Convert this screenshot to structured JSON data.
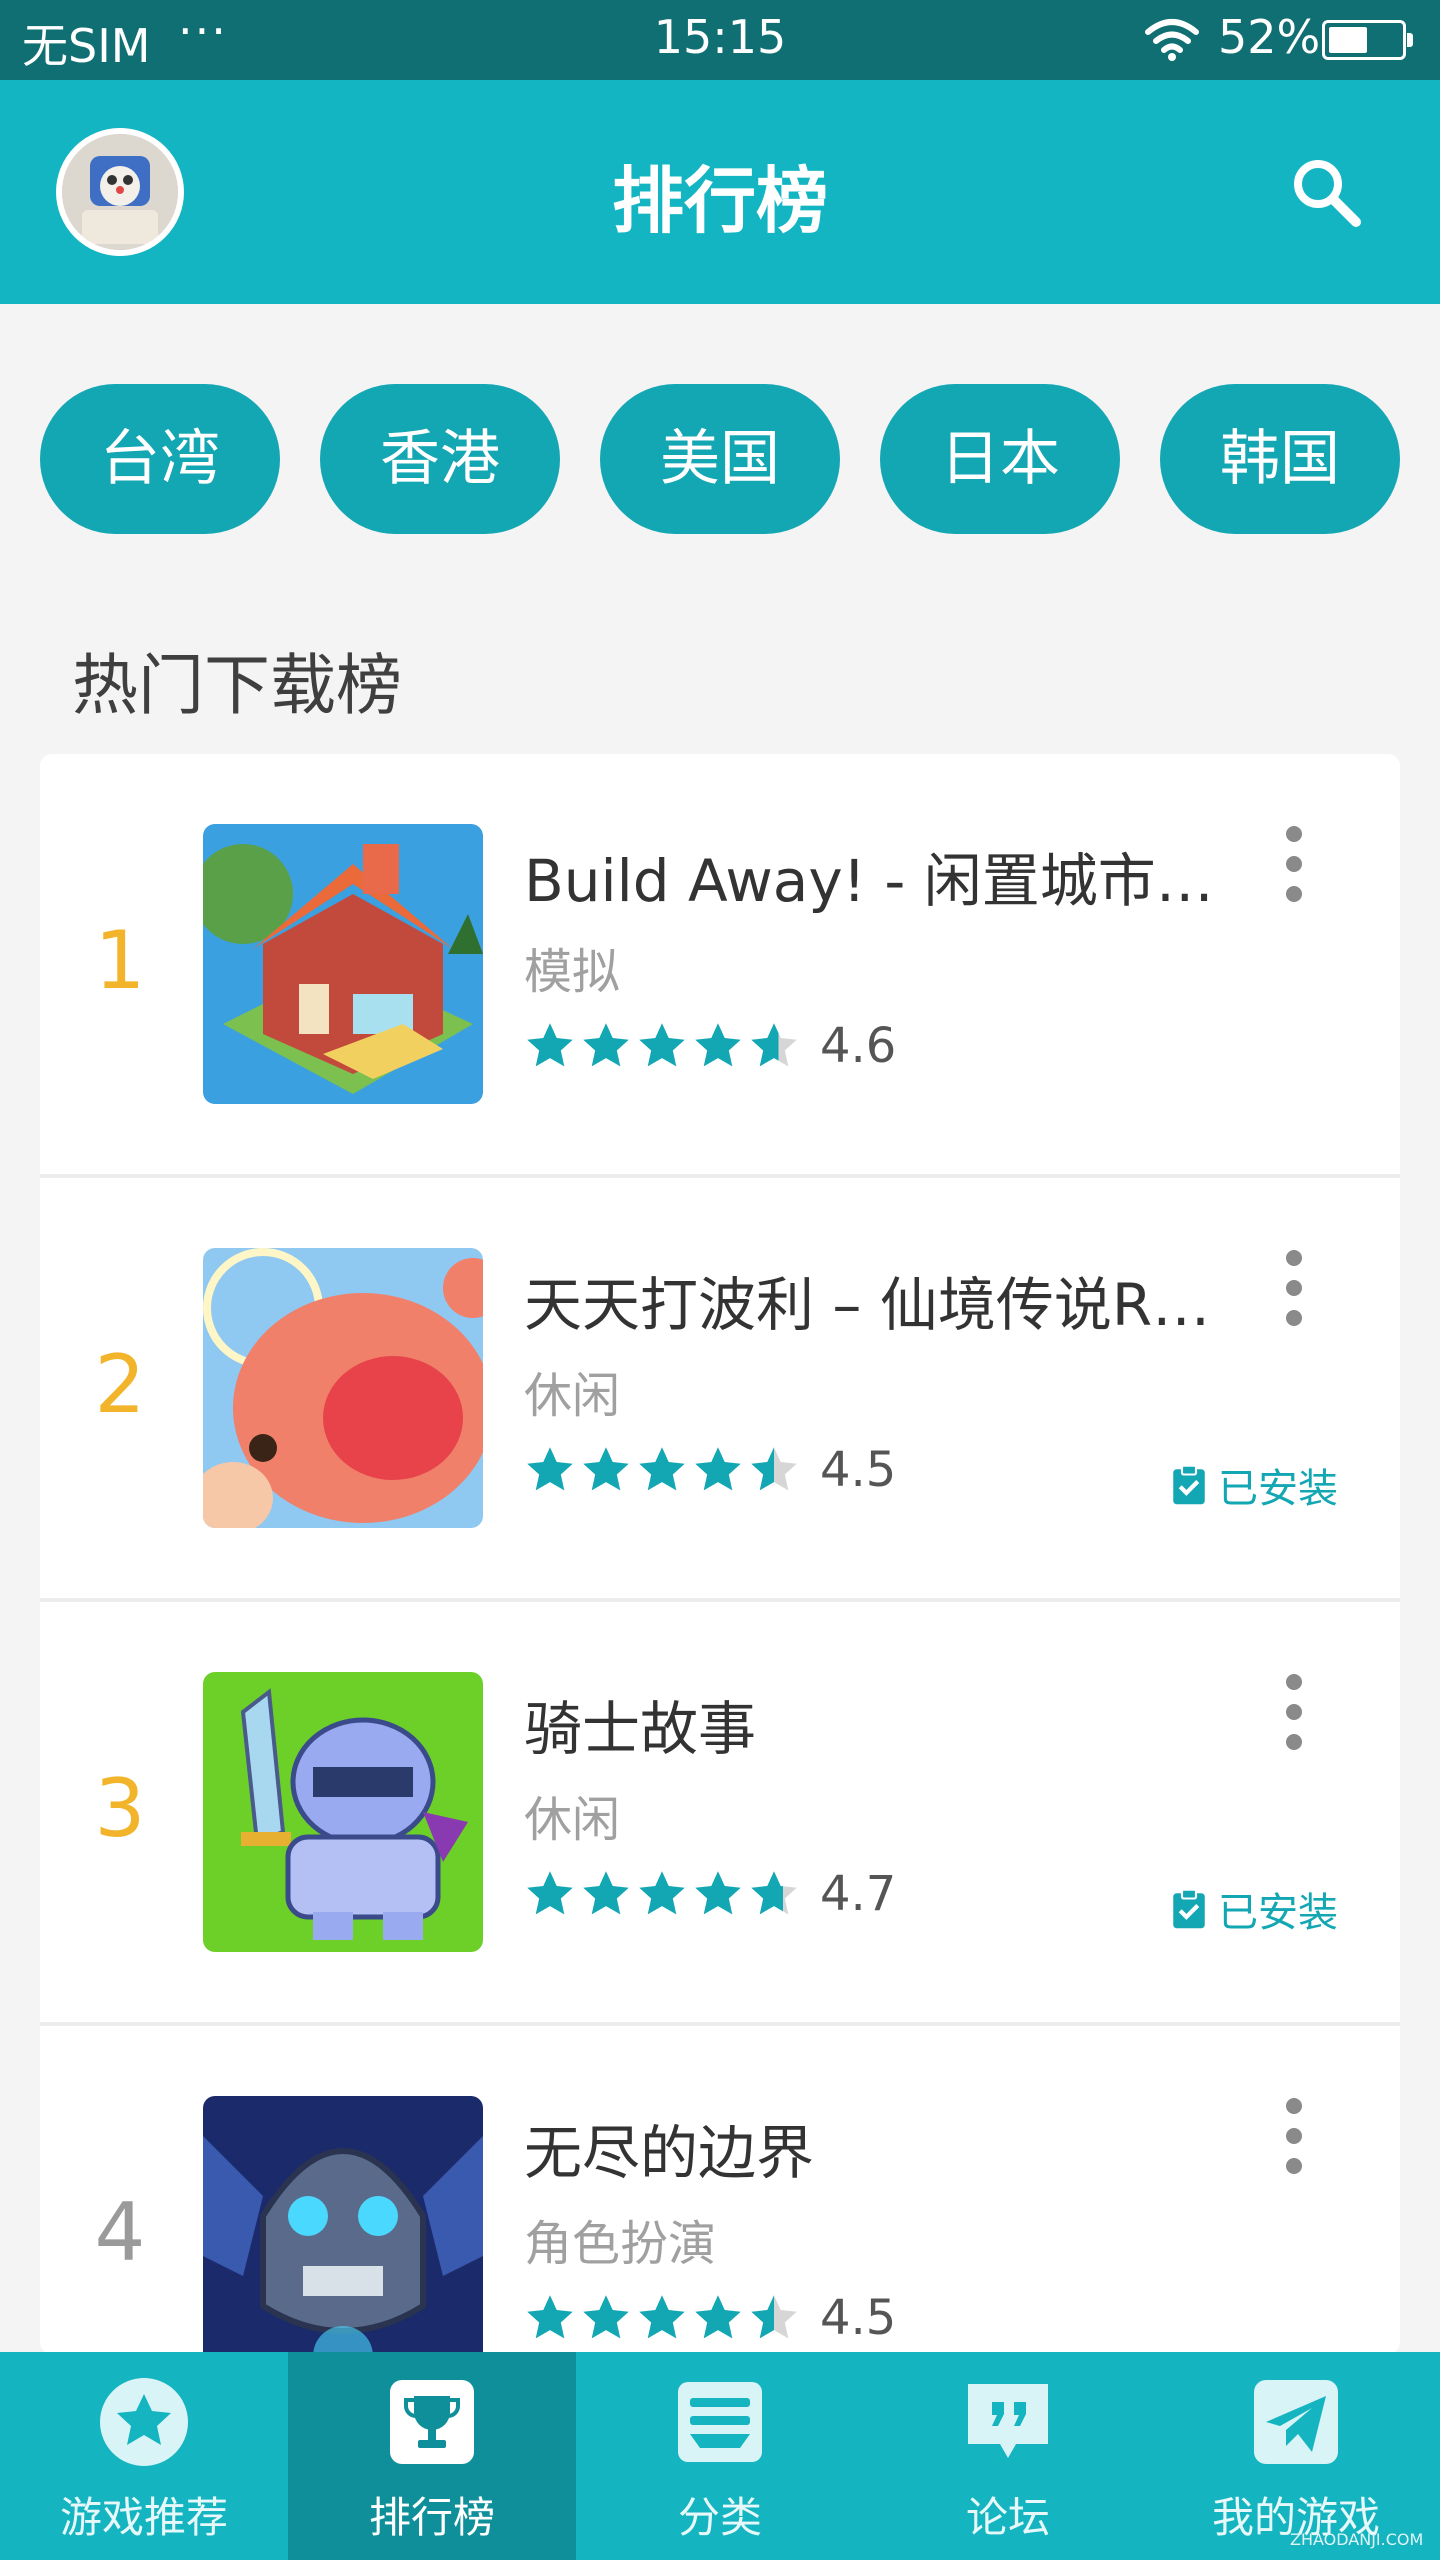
{
  "status_bar": {
    "carrier": "无SIM",
    "dots": "···",
    "time": "15:15",
    "battery_text": "52%",
    "battery_level": 0.52,
    "wifi_icon": "wifi-icon",
    "battery_icon": "battery-icon"
  },
  "header": {
    "title": "排行榜",
    "avatar_icon": "avatar",
    "search_icon": "search-icon"
  },
  "regions": [
    "台湾",
    "香港",
    "美国",
    "日本",
    "韩国"
  ],
  "section_title": "热门下载榜",
  "apps": [
    {
      "rank": "1",
      "name": " Build Away! - 闲置城市…",
      "category": "模拟",
      "rating": 4.6,
      "rating_text": "4.6",
      "installed": false
    },
    {
      "rank": "2",
      "name": "天天打波利 – 仙境传说R…",
      "category": "休闲",
      "rating": 4.5,
      "rating_text": "4.5",
      "installed": true,
      "installed_label": "已安装"
    },
    {
      "rank": "3",
      "name": "骑士故事",
      "category": "休闲",
      "rating": 4.7,
      "rating_text": "4.7",
      "installed": true,
      "installed_label": "已安装"
    },
    {
      "rank": "4",
      "name": "无尽的边界",
      "category": "角色扮演",
      "rating": 4.5,
      "rating_text": "4.5",
      "installed": false
    }
  ],
  "tabs": [
    {
      "label": "游戏推荐",
      "icon": "star-icon",
      "active": false
    },
    {
      "label": "排行榜",
      "icon": "trophy-icon",
      "active": true
    },
    {
      "label": "分类",
      "icon": "category-icon",
      "active": false
    },
    {
      "label": "论坛",
      "icon": "forum-icon",
      "active": false
    },
    {
      "label": "我的游戏",
      "icon": "paper-plane-icon",
      "active": false
    }
  ],
  "colors": {
    "status_bar": "#0f6f73",
    "header": "#13b5c3",
    "chip": "#13a6b3",
    "star": "#13a6b3",
    "rank_top": "#f2b42a",
    "tab_active": "#0f8f9a"
  },
  "watermark": "ZHAODANJI.COM"
}
